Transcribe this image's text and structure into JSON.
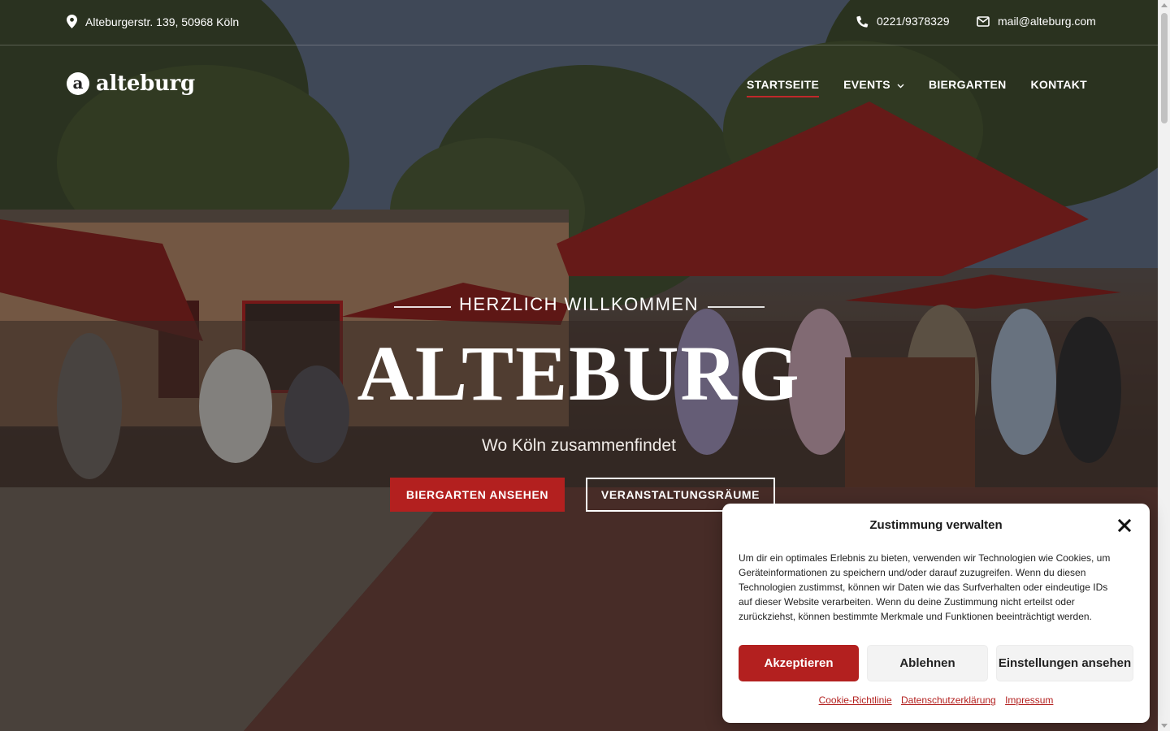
{
  "topbar": {
    "address": "Alteburgerstr. 139, 50968 Köln",
    "phone": "0221/9378329",
    "email": "mail@alteburg.com",
    "icons": [
      "location-pin-icon",
      "phone-icon",
      "envelope-icon"
    ]
  },
  "header": {
    "logo_letter": "a",
    "logo_text": "alteburg",
    "nav": [
      {
        "label": "STARTSEITE",
        "active": true
      },
      {
        "label": "EVENTS",
        "has_dropdown": true
      },
      {
        "label": "BIERGARTEN"
      },
      {
        "label": "KONTAKT"
      }
    ]
  },
  "hero": {
    "kicker": "HERZLICH WILLKOMMEN",
    "title": "ALTEBURG",
    "subtitle": "Wo Köln zusammenfindet",
    "primary_button": "BIERGARTEN ANSEHEN",
    "secondary_button": "VERANSTALTUNGSRÄUME"
  },
  "cookie_dialog": {
    "title": "Zustimmung verwalten",
    "text": "Um dir ein optimales Erlebnis zu bieten, verwenden wir Technologien wie Cookies, um Geräteinformationen zu speichern und/oder darauf zuzugreifen. Wenn du diesen Technologien zustimmst, können wir Daten wie das Surfverhalten oder eindeutige IDs auf dieser Website verarbeiten. Wenn du deine Zustimmung nicht erteilst oder zurückziehst, können bestimmte Merkmale und Funktionen beeinträchtigt werden.",
    "accept": "Akzeptieren",
    "deny": "Ablehnen",
    "preferences": "Einstellungen ansehen",
    "links": [
      "Cookie-Richtlinie",
      "Datenschutzerklärung",
      "Impressum"
    ]
  },
  "colors": {
    "accent": "#b3201f",
    "text_light": "#ffffff"
  }
}
